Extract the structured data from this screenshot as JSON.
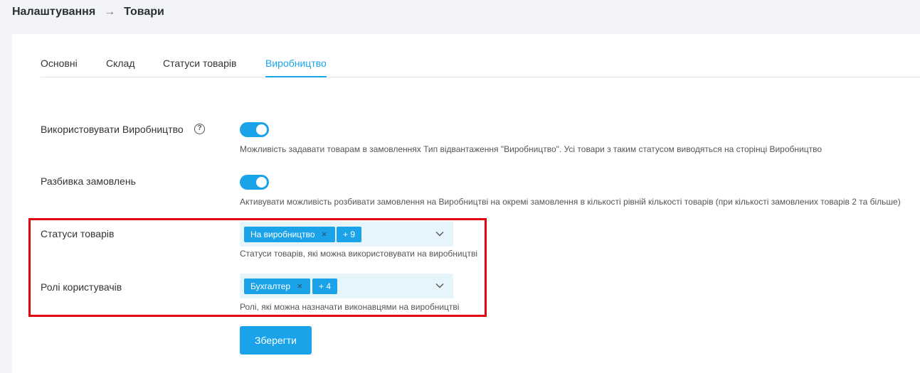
{
  "breadcrumb": {
    "parent": "Налаштування",
    "separator": "→",
    "current": "Товари"
  },
  "tabs": [
    {
      "label": "Основні",
      "active": false
    },
    {
      "label": "Склад",
      "active": false
    },
    {
      "label": "Статуси товарів",
      "active": false
    },
    {
      "label": "Виробництво",
      "active": true
    }
  ],
  "settings": {
    "use_production": {
      "label": "Використовувати Виробництво",
      "help_icon": "?",
      "enabled": true,
      "hint": "Можливість задавати товарам в замовленнях Тип відвантаження \"Виробництво\". Усі товари з таким статусом виводяться на сторінці Виробництво"
    },
    "split_orders": {
      "label": "Разбивка замовлень",
      "enabled": true,
      "hint": "Активувати можливість розбивати замовлення на Виробництві на окремі замовлення в кількості рівній кількості товарів (при кількості замовлених товарів 2 та більше)"
    },
    "product_statuses": {
      "label": "Статуси товарів",
      "chip": "На виробництво",
      "more": "+ 9",
      "hint": "Статуси товарів, які можна використовувати на виробництві"
    },
    "user_roles": {
      "label": "Ролі користувачів",
      "chip": "Бухгалтер",
      "more": "+ 4",
      "hint": "Ролі, які можна назначати виконавцями на виробництві"
    }
  },
  "actions": {
    "save_label": "Зберегти"
  },
  "colors": {
    "accent": "#1aa3e8",
    "highlight_border": "#e0000f",
    "select_bg": "#e6f4fc"
  }
}
